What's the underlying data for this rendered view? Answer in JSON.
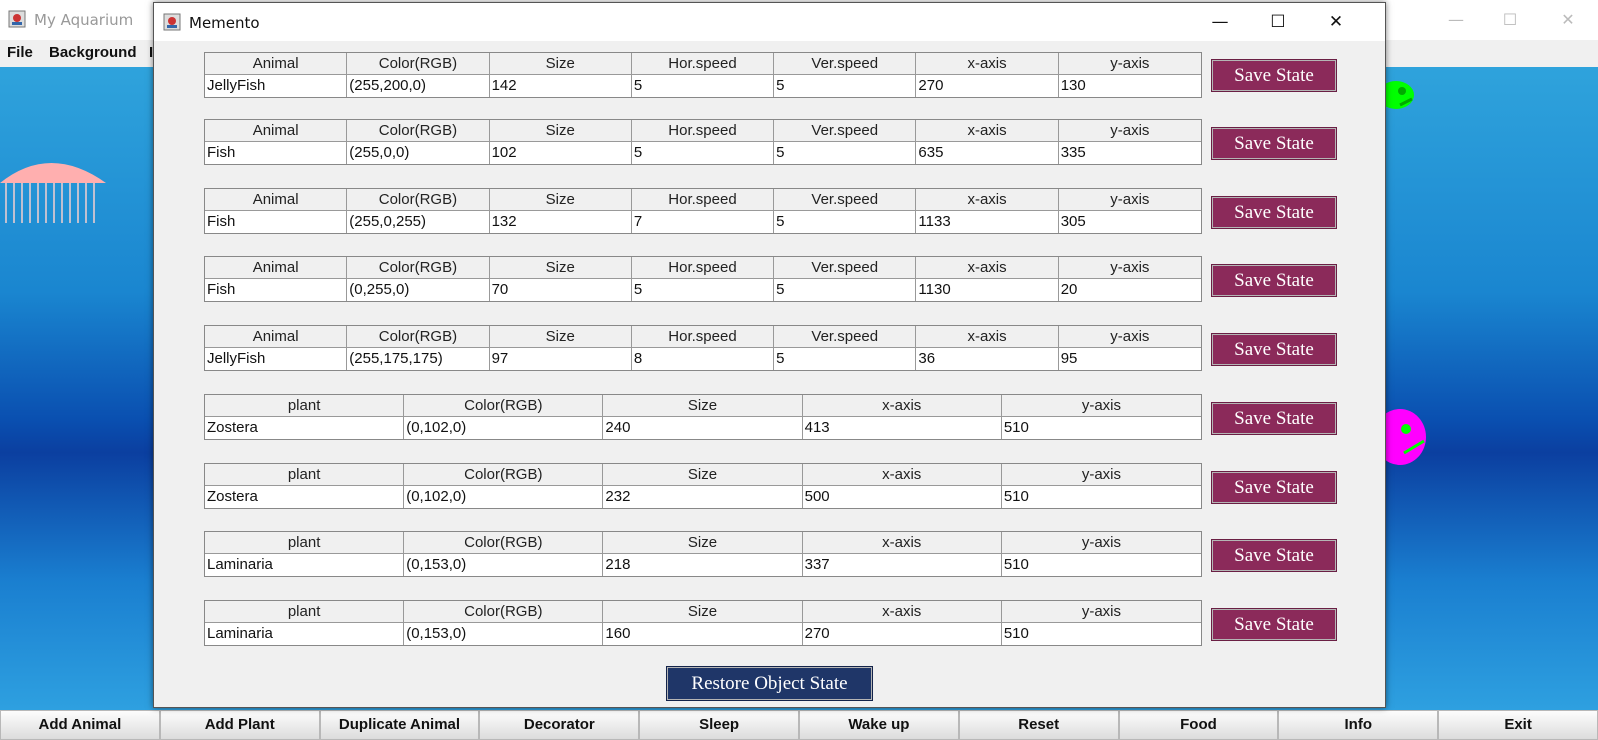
{
  "main_window": {
    "title": "My Aquarium",
    "menu": [
      "File",
      "Background",
      "I"
    ]
  },
  "bottom_toolbar": [
    "Add Animal",
    "Add Plant",
    "Duplicate Animal",
    "Decorator",
    "Sleep",
    "Wake up",
    "Reset",
    "Food",
    "Info",
    "Exit"
  ],
  "dialog": {
    "title": "Memento",
    "save_label": "Save State",
    "restore_label": "Restore Object State",
    "animal_headers": [
      "Animal",
      "Color(RGB)",
      "Size",
      "Hor.speed",
      "Ver.speed",
      "x-axis",
      "y-axis"
    ],
    "plant_headers": [
      "plant",
      "Color(RGB)",
      "Size",
      "x-axis",
      "y-axis"
    ],
    "animals": [
      [
        "JellyFish",
        "(255,200,0)",
        "142",
        "5",
        "5",
        "270",
        "130"
      ],
      [
        "Fish",
        "(255,0,0)",
        "102",
        "5",
        "5",
        "635",
        "335"
      ],
      [
        "Fish",
        "(255,0,255)",
        "132",
        "7",
        "5",
        "1133",
        "305"
      ],
      [
        "Fish",
        "(0,255,0)",
        "70",
        "5",
        "5",
        "1130",
        "20"
      ],
      [
        "JellyFish",
        "(255,175,175)",
        "97",
        "8",
        "5",
        "36",
        "95"
      ]
    ],
    "plants": [
      [
        "Zostera",
        "(0,102,0)",
        "240",
        "413",
        "510"
      ],
      [
        "Zostera",
        "(0,102,0)",
        "232",
        "500",
        "510"
      ],
      [
        "Laminaria",
        "(0,153,0)",
        "218",
        "337",
        "510"
      ],
      [
        "Laminaria",
        "(0,153,0)",
        "160",
        "270",
        "510"
      ]
    ]
  },
  "colors": {
    "save_button": "#8b2a5a",
    "restore_button": "#1f3668",
    "jellyfish_pink": "#ffafaf",
    "fish_green": "#00ff00",
    "fish_magenta": "#ff00ff"
  }
}
